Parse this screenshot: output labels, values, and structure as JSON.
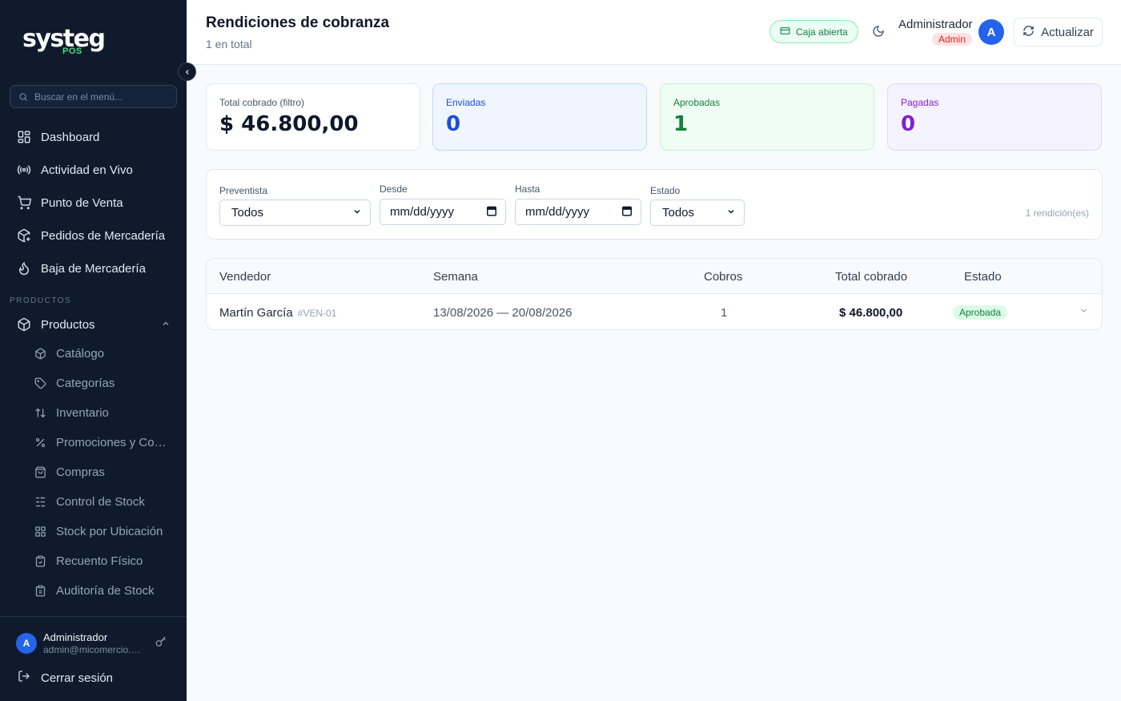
{
  "sidebar": {
    "logo_text": "systeg",
    "logo_sub": "POS",
    "search_placeholder": "Buscar en el menú...",
    "items": [
      {
        "label": "Dashboard",
        "icon": "dashboard-icon"
      },
      {
        "label": "Actividad en Vivo",
        "icon": "broadcast-icon"
      },
      {
        "label": "Punto de Venta",
        "icon": "cart-icon"
      },
      {
        "label": "Pedidos de Mercadería",
        "icon": "package-plus-icon"
      },
      {
        "label": "Baja de Mercadería",
        "icon": "flame-icon"
      }
    ],
    "section_label": "PRODUCTOS",
    "group_label": "Productos",
    "sub_items": [
      {
        "label": "Catálogo",
        "icon": "box-icon"
      },
      {
        "label": "Categorías",
        "icon": "tag-icon"
      },
      {
        "label": "Inventario",
        "icon": "sort-arrows-icon"
      },
      {
        "label": "Promociones y Combos",
        "icon": "percent-icon"
      },
      {
        "label": "Compras",
        "icon": "shopping-bag-icon"
      },
      {
        "label": "Control de Stock",
        "icon": "sliders-icon"
      },
      {
        "label": "Stock por Ubicación",
        "icon": "grid-icon"
      },
      {
        "label": "Recuento Físico",
        "icon": "clipboard-icon"
      },
      {
        "label": "Auditoría de Stock",
        "icon": "clipboard-list-icon"
      }
    ],
    "user": {
      "initial": "A",
      "name": "Administrador",
      "email": "admin@micomercio.com"
    },
    "logout_label": "Cerrar sesión"
  },
  "header": {
    "title": "Rendiciones de cobranza",
    "subtitle": "1 en total",
    "caja_label": "Caja abierta",
    "user_name": "Administrador",
    "user_role": "Admin",
    "user_initial": "A",
    "refresh_label": "Actualizar"
  },
  "stats": [
    {
      "label": "Total cobrado (filtro)",
      "value": "$ 46.800,00"
    },
    {
      "label": "Enviadas",
      "value": "0"
    },
    {
      "label": "Aprobadas",
      "value": "1"
    },
    {
      "label": "Pagadas",
      "value": "0"
    }
  ],
  "filters": {
    "preventista": {
      "label": "Preventista",
      "value": "Todos"
    },
    "desde": {
      "label": "Desde",
      "value": "mm/dd/yyyy"
    },
    "hasta": {
      "label": "Hasta",
      "value": "mm/dd/yyyy"
    },
    "estado": {
      "label": "Estado",
      "value": "Todos"
    },
    "count_text": "1 rendición(es)"
  },
  "table": {
    "headers": [
      "Vendedor",
      "Semana",
      "Cobros",
      "Total cobrado",
      "Estado"
    ],
    "rows": [
      {
        "vendedor": "Martín García",
        "code": "#VEN-01",
        "semana": "13/08/2026 — 20/08/2026",
        "cobros": "1",
        "total": "$ 46.800,00",
        "estado": "Aprobada"
      }
    ]
  },
  "colors": {
    "sidebar_bg": "#0f1b2d",
    "accent_blue": "#2563eb",
    "approved_green": "#15803d",
    "paid_purple": "#7e22ce"
  }
}
